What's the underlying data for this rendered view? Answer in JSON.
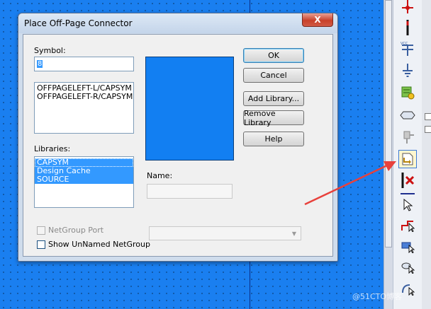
{
  "dialog": {
    "title": "Place Off-Page Connector",
    "close_label": "X",
    "symbol_label": "Symbol:",
    "symbol_value": "8",
    "symbols": [
      "OFFPAGELEFT-L/CAPSYM",
      "OFFPAGELEFT-R/CAPSYM"
    ],
    "libraries_label": "Libraries:",
    "libraries": [
      "CAPSYM",
      "Design Cache",
      "SOURCE"
    ],
    "name_label": "Name:",
    "name_value": "",
    "buttons": {
      "ok": "OK",
      "cancel": "Cancel",
      "add_library": "Add Library...",
      "remove_library": "Remove Library",
      "help": "Help"
    },
    "netgroup_port_label": "NetGroup Port",
    "show_unnamed_label": "Show UnNamed NetGroup",
    "netgroup_value": ""
  },
  "toolbar": {
    "tools": [
      {
        "icon": "place-junction-icon"
      },
      {
        "icon": "place-wire-end-icon"
      },
      {
        "icon": "place-power-icon"
      },
      {
        "icon": "place-ground-icon"
      },
      {
        "icon": "place-hierarchical-block-icon"
      },
      {
        "icon": "place-port-icon"
      },
      {
        "icon": "place-pin-icon"
      },
      {
        "icon": "place-off-page-connector-icon"
      },
      {
        "icon": "place-no-connect-icon"
      },
      {
        "icon": "select-arrow-icon"
      },
      {
        "icon": "place-polyline-icon"
      },
      {
        "icon": "place-rectangle-icon"
      },
      {
        "icon": "place-ellipse-icon"
      },
      {
        "icon": "place-arc-icon"
      }
    ]
  },
  "watermark": "@51CTO博客",
  "colors": {
    "canvas": "#1a7ff0",
    "preview": "#127ff2",
    "selection": "#3399ff",
    "annotation_arrow": "#e8413c"
  }
}
